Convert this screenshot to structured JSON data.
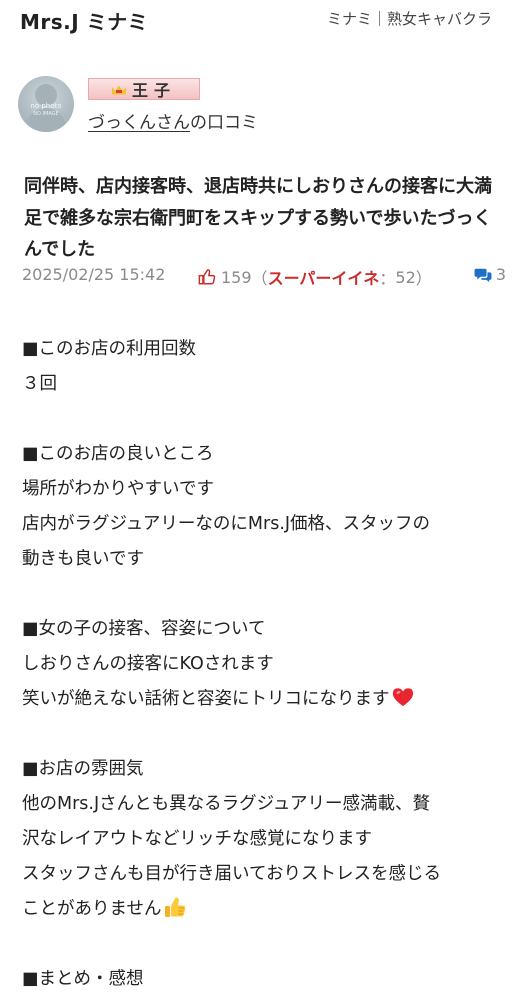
{
  "header": {
    "shop_name": "Mrs.J ミナミ",
    "shop_category": "ミナミ｜熟女キャバクラ"
  },
  "reviewer": {
    "avatar_text_1": "no photo",
    "avatar_text_2": "NO IMAGE",
    "rank": "王子",
    "name": "づっくんさん",
    "suffix": "の口コミ"
  },
  "review": {
    "title": "同伴時、店内接客時、退店時共にしおりさんの接客に大満足で雑多な宗右衛門町をスキップする勢いで歩いたづっくんでした",
    "date": "2025/02/25 15:42",
    "like_count": "159",
    "paren_open": "（",
    "super_like_label": "スーパーイイネ",
    "super_like_sep": "：",
    "super_like_count": "52",
    "paren_close": "）",
    "comment_count": "3"
  },
  "body": {
    "s1_heading": "■このお店の利用回数",
    "s1_l1": "３回",
    "s2_heading": "■このお店の良いところ",
    "s2_l1": "場所がわかりやすいです",
    "s2_l2": "店内がラグジュアリーなのにMrs.J価格、スタッフの",
    "s2_l3": "動きも良いです",
    "s3_heading": "■女の子の接客、容姿について",
    "s3_l1": "しおりさんの接客にKOされます",
    "s3_l2": "笑いが絶えない話術と容姿にトリコになります",
    "s4_heading": "■お店の雰囲気",
    "s4_l1": "他のMrs.Jさんとも異なるラグジュアリー感満載、贅",
    "s4_l2": "沢なレイアウトなどリッチな感覚になります",
    "s4_l3": "スタッフさんも目が行き届いておりストレスを感じる",
    "s4_l4": "ことがありません",
    "s5_heading": "■まとめ・感想"
  },
  "icons": {
    "thumb": "thumbs-up-outline-icon",
    "comment": "speech-bubbles-icon",
    "heart": "red-heart-emoji",
    "thumbsup": "thumbs-up-emoji",
    "crown": "crown-icon"
  },
  "colors": {
    "super_like": "#cc2b2b",
    "thumb_icon": "#cc2b2b",
    "comment_icon": "#1f6fc5",
    "rank_badge_bg": "#f3c2c2"
  }
}
